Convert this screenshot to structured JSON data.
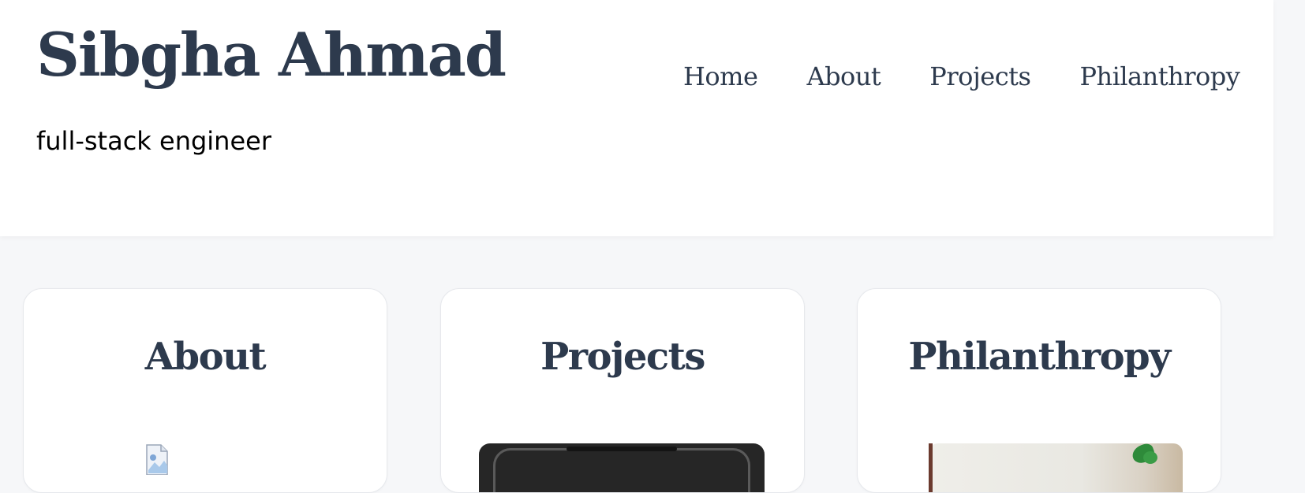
{
  "header": {
    "title": "Sibgha Ahmad",
    "tagline": "full-stack engineer"
  },
  "nav": {
    "items": [
      {
        "label": "Home"
      },
      {
        "label": "About"
      },
      {
        "label": "Projects"
      },
      {
        "label": "Philanthropy"
      }
    ]
  },
  "cards": [
    {
      "title": "About",
      "image": "broken-image-icon"
    },
    {
      "title": "Projects",
      "image": "phone-photo"
    },
    {
      "title": "Philanthropy",
      "image": "room-photo"
    }
  ],
  "colors": {
    "heading": "#2d3a4d",
    "page_background": "#f6f7f9",
    "card_background": "#ffffff"
  }
}
